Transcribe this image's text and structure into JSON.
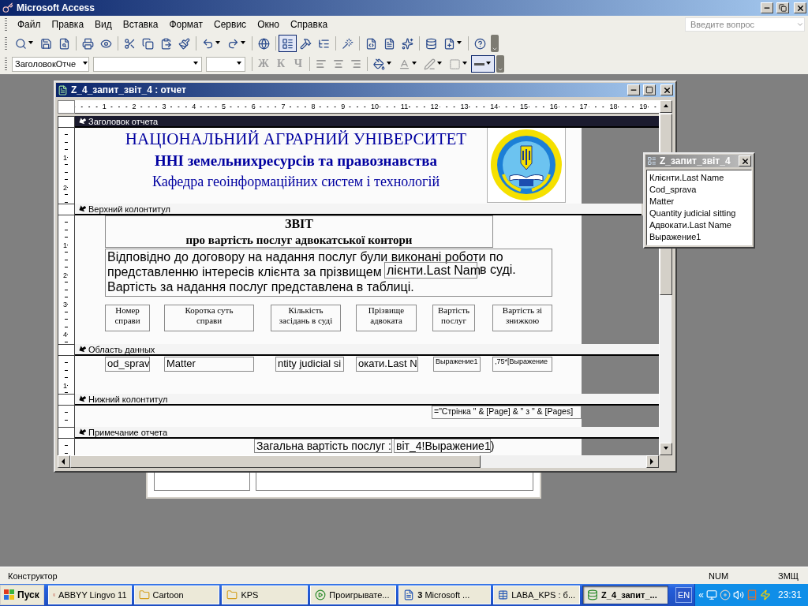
{
  "app_window": {
    "title": "Microsoft Access"
  },
  "menu": [
    {
      "label": "Файл"
    },
    {
      "label": "Правка"
    },
    {
      "label": "Вид"
    },
    {
      "label": "Вставка"
    },
    {
      "label": "Формат"
    },
    {
      "label": "Сервис"
    },
    {
      "label": "Окно"
    },
    {
      "label": "Справка"
    }
  ],
  "help_box": {
    "placeholder": "Введите вопрос"
  },
  "toolbar_1": [
    {
      "kind": "split",
      "selected": false
    },
    {
      "kind": "button",
      "selected": false
    },
    {
      "kind": "button",
      "selected": false
    },
    {
      "kind": "button",
      "selected": false
    },
    {
      "kind": "button",
      "selected": false
    },
    {
      "kind": "button",
      "selected": false
    },
    {
      "kind": "button",
      "selected": false
    },
    {
      "kind": "button",
      "selected": false
    },
    {
      "kind": "button",
      "selected": false
    },
    {
      "kind": "split",
      "selected": false
    },
    {
      "kind": "split",
      "selected": false
    },
    {
      "kind": "button",
      "selected": false
    },
    {
      "kind": "button",
      "selected": true
    },
    {
      "kind": "button",
      "selected": false
    },
    {
      "kind": "button",
      "selected": false
    },
    {
      "kind": "button",
      "selected": false
    },
    {
      "kind": "button",
      "selected": false
    },
    {
      "kind": "button",
      "selected": false
    },
    {
      "kind": "button",
      "selected": false
    },
    {
      "kind": "button",
      "selected": false
    },
    {
      "kind": "split",
      "selected": false
    },
    {
      "kind": "button",
      "selected": false
    }
  ],
  "toolbar_2": {
    "object_box": {
      "value": "ЗаголовокОтче"
    },
    "format_buttons": [
      {
        "label": "Ж",
        "disabled": true
      },
      {
        "label": "К",
        "disabled": true
      },
      {
        "label": "Ч",
        "disabled": true
      }
    ],
    "line_width": {
      "selected": true
    }
  },
  "report_window": {
    "title": "Z_4_запит_звіт_4 : отчет",
    "ruler_marks": [
      "1",
      "2",
      "3",
      "4",
      "5",
      "6",
      "7",
      "8",
      "9",
      "10",
      "11",
      "12",
      "13",
      "14",
      "15",
      "16",
      "17",
      "18",
      "19"
    ],
    "sections": [
      {
        "name": "Заголовок отчета",
        "selected": true,
        "ruler_marks": [
          "1",
          "2"
        ],
        "controls": [
          {
            "kind": "caption",
            "text": "НАЦІОНАЛЬНИЙ АГРАРНИЙ УНІВЕРСИТЕТ"
          },
          {
            "kind": "caption",
            "text": "ННІ земельнихресурсів та правознавства"
          },
          {
            "kind": "caption",
            "text": "Кафедра геоінформаційних систем і технологій"
          },
          {
            "kind": "image"
          }
        ]
      },
      {
        "name": "Верхний колонтитул",
        "selected": false,
        "ruler_marks": [
          "1",
          "2",
          "3",
          "4"
        ],
        "controls": [
          {
            "kind": "heading",
            "lines": [
              "ЗВІТ",
              "про вартість послуг адвокатської контори"
            ]
          },
          {
            "kind": "memo",
            "lines": [
              "Відповідно до договору на надання послуг були виконані роботи по",
              "представленню інтересів клієнта за прізвищем",
              "Вартість  за надання послуг представлена в таблиці."
            ]
          },
          {
            "kind": "textbox",
            "text": "лієнти.Last Nam"
          },
          {
            "kind": "caption",
            "text": "в суді."
          },
          {
            "kind": "label",
            "lines": [
              "Номер",
              "справи"
            ]
          },
          {
            "kind": "label",
            "lines": [
              "Коротка суть",
              "справи"
            ]
          },
          {
            "kind": "label",
            "lines": [
              "Кількість",
              "засідань в суді"
            ]
          },
          {
            "kind": "label",
            "lines": [
              "Прізвище",
              "адвоката"
            ]
          },
          {
            "kind": "label",
            "lines": [
              "Вартість",
              "послуг"
            ]
          },
          {
            "kind": "label",
            "lines": [
              "Вартість зі",
              "знижкою"
            ]
          }
        ]
      },
      {
        "name": "Область данных",
        "selected": false,
        "ruler_marks": [
          "1"
        ],
        "controls": [
          {
            "kind": "textbox",
            "text": "od_sprav"
          },
          {
            "kind": "textbox",
            "text": "Matter"
          },
          {
            "kind": "textbox",
            "text": "ntity judicial si"
          },
          {
            "kind": "textbox",
            "text": "окати.Last N"
          },
          {
            "kind": "textbox",
            "text": "Выражение1"
          },
          {
            "kind": "textbox",
            "text": ",75*[Выражение"
          }
        ]
      },
      {
        "name": "Нижний колонтитул",
        "selected": false,
        "controls": [
          {
            "kind": "textbox",
            "text": "=\"Стрінка \" & [Page] & \" з \" & [Pages]"
          }
        ]
      },
      {
        "name": "Примечание отчета",
        "selected": false,
        "controls": [
          {
            "kind": "label",
            "lines": [
              "Загальна вартість послуг :"
            ]
          },
          {
            "kind": "textbox",
            "text": "віт_4!Выражение1)"
          }
        ]
      }
    ]
  },
  "field_list": {
    "title": "Z_запит_звіт_4",
    "fields": [
      "Клієнти.Last Name",
      "Cod_sprava",
      "Matter",
      "Quantity judicial sitting",
      "Адвокати.Last Name",
      "Выражение1"
    ]
  },
  "status_bar": {
    "mode": "Конструктор",
    "indicators": [
      "NUM",
      "ЗМЩ"
    ]
  },
  "taskbar": {
    "start": "Пуск",
    "tasks": [
      {
        "label": "ABBYY Lingvo 11",
        "selected": false
      },
      {
        "label": "Cartoon",
        "selected": false
      },
      {
        "label": "KPS",
        "selected": false
      },
      {
        "label": "Проигрывате...",
        "selected": false
      },
      {
        "label": "**3** Microsoft ...",
        "selected": false
      },
      {
        "label": "LABA_KPS : б...",
        "selected": false
      },
      {
        "label": "Z_4_запит_...",
        "selected": true
      }
    ],
    "language": "EN",
    "tray_expand": "«",
    "clock": "23:31"
  }
}
